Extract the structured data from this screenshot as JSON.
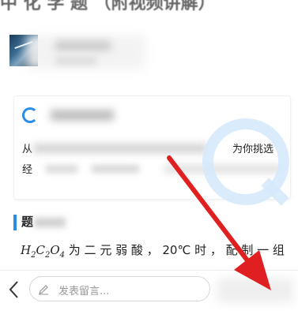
{
  "header": {
    "title_fragment": "中 化 学 题 （附视频讲解）"
  },
  "card": {
    "line1_start": "从",
    "line1_end": "为你挑选",
    "line2_start": "经"
  },
  "section": {
    "label": "题"
  },
  "question": {
    "formula_main": "H",
    "formula_sub1": "2",
    "formula_c": "C",
    "formula_sub2": "2",
    "formula_o": "O",
    "formula_sub3": "4",
    "text": " 为 二 元 弱 酸 ， 20℃ 时 ， 配 制 一 组"
  },
  "comment_bar": {
    "placeholder": "发表留言..."
  },
  "colors": {
    "accent_blue": "#2a8de6",
    "arrow_red": "#e02020",
    "watermark": "#d4e9fb"
  },
  "icons": {
    "back": "chevron-left-icon",
    "pencil": "pencil-icon",
    "card": "refresh-circle-icon"
  }
}
